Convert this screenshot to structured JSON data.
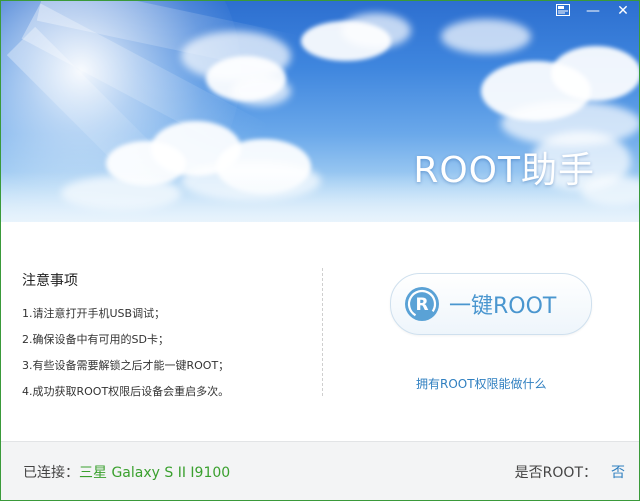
{
  "window": {
    "title": "ROOT助手",
    "controls": {
      "skin_icon": "skin-icon",
      "minimize_label": "—",
      "close_label": "✕"
    }
  },
  "notes": {
    "heading": "注意事项",
    "items": [
      "1.请注意打开手机USB调试；",
      "2.确保设备中有可用的SD卡；",
      "3.有些设备需要解锁之后才能一键ROOT；",
      "4.成功获取ROOT权限后设备会重启多次。"
    ]
  },
  "root_button": {
    "icon_letter": "R",
    "label": "一键ROOT"
  },
  "root_info_link": "拥有ROOT权限能做什么",
  "status": {
    "connected_label": "已连接：",
    "device_name": "三星 Galaxy S II  I9100",
    "root_label": "是否ROOT：",
    "root_value": "否"
  },
  "colors": {
    "accent_blue": "#4a96cf",
    "link_blue": "#2f7fc0",
    "device_green": "#3aa02e",
    "window_border": "#3a9a3a"
  }
}
